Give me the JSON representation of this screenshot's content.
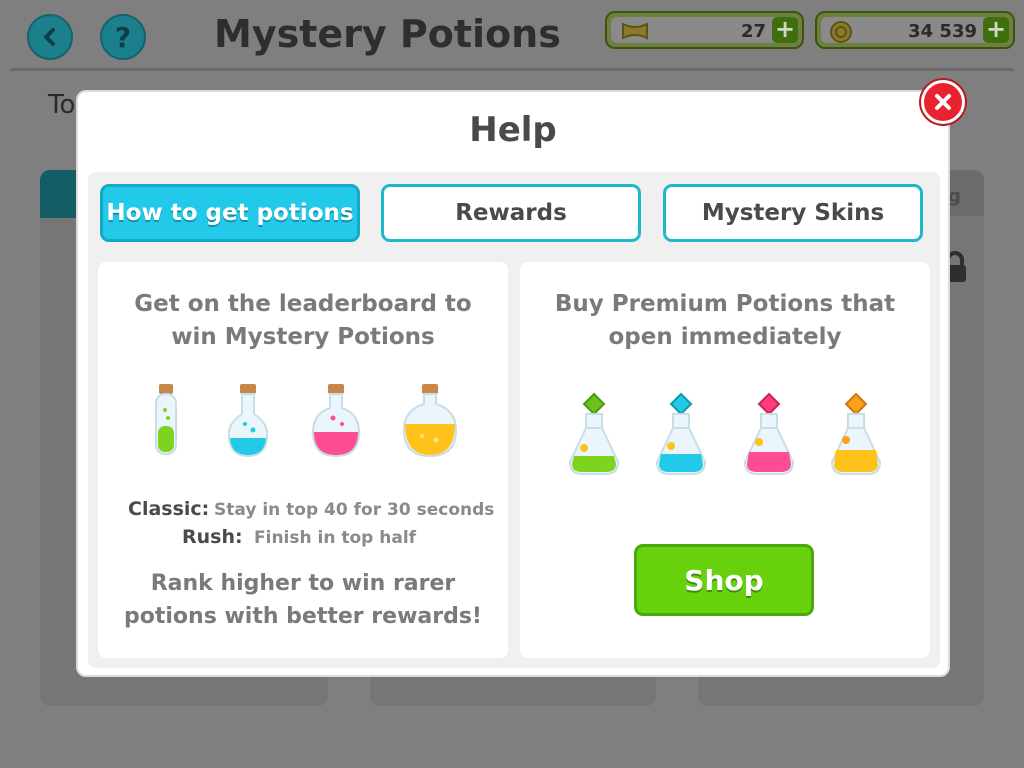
{
  "header": {
    "title": "Mystery Potions",
    "tickets": "27",
    "coins": "34 539",
    "plus_symbol": "+"
  },
  "background": {
    "subtitle_left": "To",
    "subtitle_right": ")",
    "card_3_label": "g"
  },
  "modal": {
    "title": "Help",
    "tabs": [
      {
        "label": "How to get potions",
        "active": true
      },
      {
        "label": "Rewards",
        "active": false
      },
      {
        "label": "Mystery Skins",
        "active": false
      }
    ],
    "left_card": {
      "heading": "Get on the leaderboard to win Mystery Potions",
      "potion_colors": [
        "#7ed321",
        "#22c9e8",
        "#ff4d94",
        "#ffc21a"
      ],
      "classic_label": "Classic:",
      "classic_desc": "Stay in top 40 for 30 seconds",
      "rush_label": "Rush:",
      "rush_desc": "Finish in top half",
      "rank_text": "Rank higher to win rarer potions with better rewards!"
    },
    "right_card": {
      "heading": "Buy Premium Potions that open immediately",
      "potion_colors": [
        "#7ed321",
        "#22c9e8",
        "#ff4d94",
        "#ffc21a"
      ],
      "shop_label": "Shop"
    }
  },
  "colors": {
    "accent": "#22c9e8",
    "shop_green": "#67d10e",
    "close_red": "#e8232f"
  },
  "icons": [
    "back-arrow-icon",
    "question-icon",
    "ticket-icon",
    "coin-icon",
    "close-icon",
    "padlock-icon"
  ]
}
